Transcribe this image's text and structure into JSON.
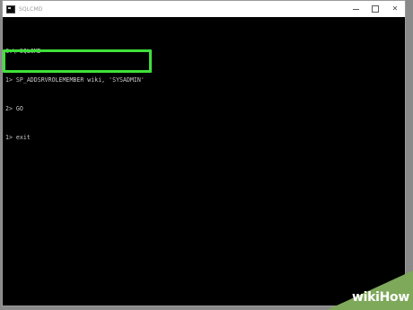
{
  "window": {
    "title": "SQLCMD",
    "icon": "console-app-icon"
  },
  "console": {
    "lines": [
      "C:\\>SQLCMD",
      "1> SP_ADDSRVROLEMEMBER wiki, 'SYSADMIN'",
      "2> GO",
      "1> exit"
    ]
  },
  "highlight": {
    "color": "#3fe13a"
  },
  "watermark": {
    "text_a": "wiki",
    "text_b": "How",
    "color": "#7ea85a"
  }
}
